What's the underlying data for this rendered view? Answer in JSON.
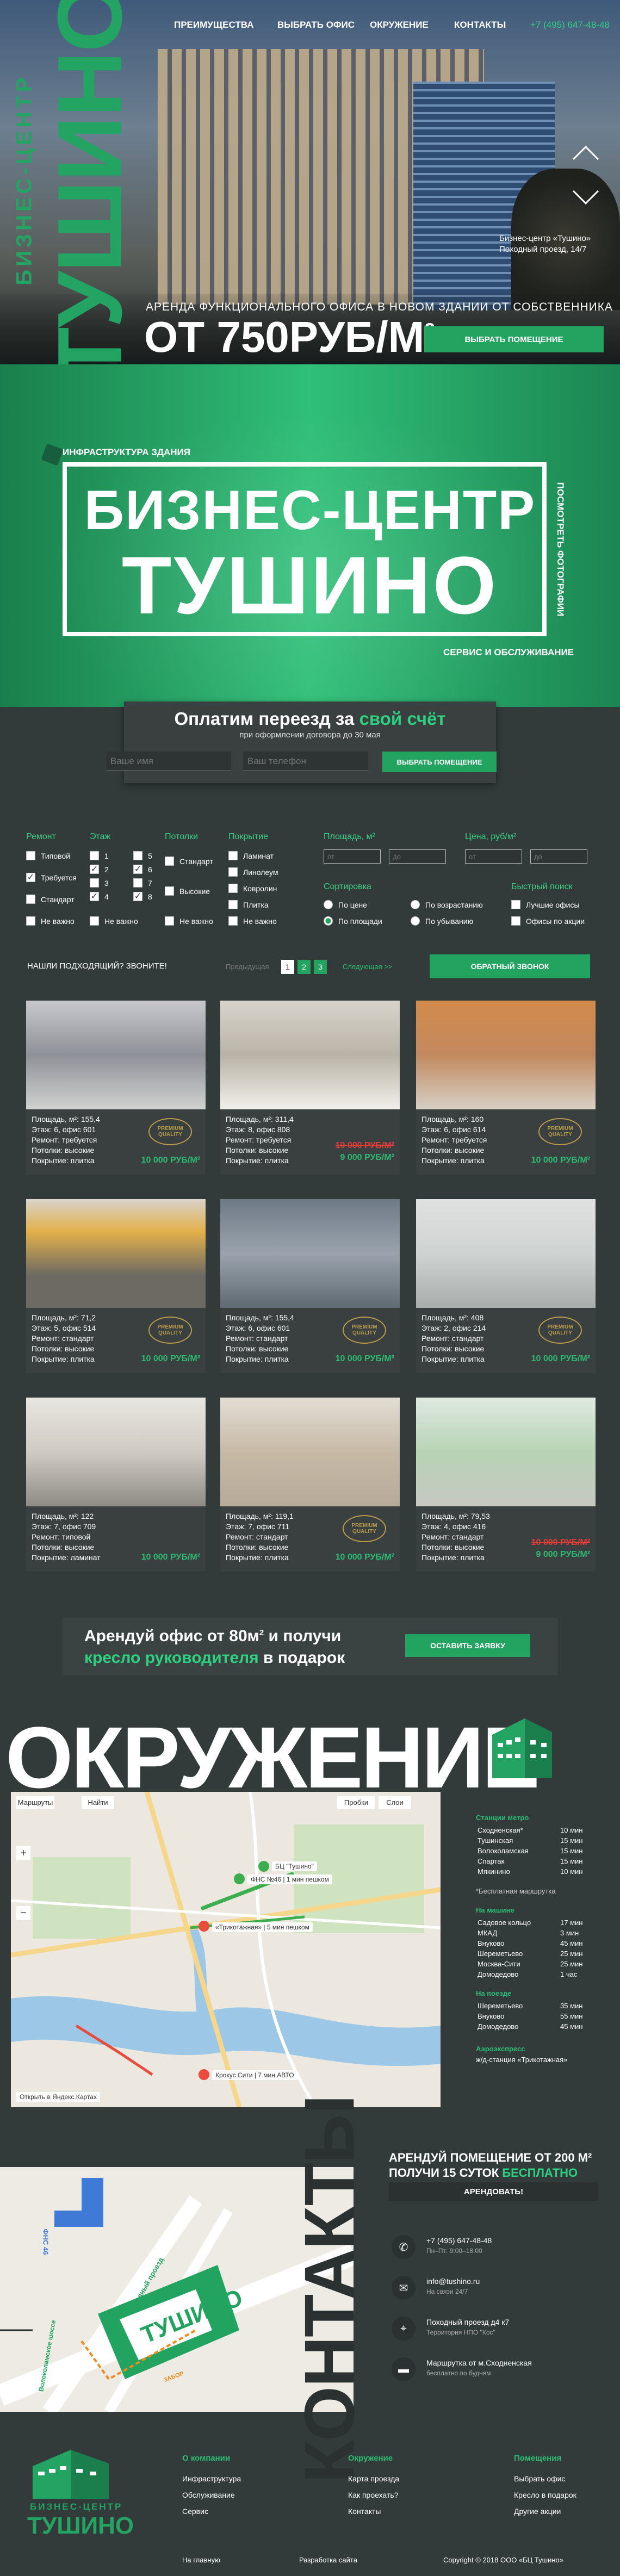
{
  "header": {
    "logo_vertical_top": "БИЗНЕС-ЦЕНТР",
    "logo_vertical_bottom": "ТУШИНО",
    "nav": [
      "ПРЕИМУЩЕСТВА",
      "ВЫБРАТЬ ОФИС",
      "ОКРУЖЕНИЕ",
      "КОНТАКТЫ"
    ],
    "phone": "+7 (495) 647-48-48",
    "photo_caption_1": "Бизнес-центр «Тушино»",
    "photo_caption_2": "Походный проезд, 14/7",
    "tagline": "АРЕНДА ФУНКЦИОНАЛЬНОГО ОФИСА В НОВОМ ЗДАНИИ ОТ СОБСТВЕННИКА",
    "price_prefix": "ОТ 750РУБ/М",
    "price_sup": "2",
    "cta": "ВЫБРАТЬ ПОМЕЩЕНИЕ"
  },
  "banner": {
    "side_top": "ИНФРАСТРУКТУРА ЗДАНИЯ",
    "side_right": "ПОСМОТРЕТЬ ФОТОГРАФИИ",
    "side_bottom": "СЕРВИС И ОБСЛУЖИВАНИЕ",
    "title_1": "БИЗНЕС-ЦЕНТР",
    "title_2": "ТУШИНО"
  },
  "move_form": {
    "title_prefix": "Оплатим переезд за ",
    "title_highlight": "свой счёт",
    "subtitle": "при оформлении договора до 30 мая",
    "name_placeholder": "Ваше имя",
    "phone_placeholder": "Ваш телефон",
    "submit": "ВЫБРАТЬ ПОМЕЩЕНИЕ"
  },
  "filters": {
    "repair": {
      "label": "Ремонт",
      "options": [
        "Типовой",
        "Требуется",
        "Стандарт",
        "Не важно"
      ]
    },
    "floor": {
      "label": "Этаж",
      "options": [
        "1",
        "2",
        "3",
        "4",
        "5",
        "6",
        "7",
        "8",
        "Не важно"
      ]
    },
    "ceiling": {
      "label": "Потолки",
      "options": [
        "Стандарт",
        "Высокие",
        "Не важно"
      ]
    },
    "cover": {
      "label": "Покрытие",
      "options": [
        "Ламинат",
        "Линолеум",
        "Ковролин",
        "Плитка",
        "Не важно"
      ]
    },
    "area": {
      "label": "Площадь, м²",
      "from": "от",
      "to": "до"
    },
    "price": {
      "label": "Цена, руб/м²",
      "from": "от",
      "to": "до"
    },
    "sort": {
      "label": "Сортировка",
      "options": [
        "По цене",
        "По возрастанию",
        "По площади",
        "По убыванию"
      ]
    },
    "quick": {
      "label": "Быстрый поиск",
      "options": [
        "Лучшие офисы",
        "Офисы по акции"
      ]
    }
  },
  "listing": {
    "hint": "НАШЛИ ПОДХОДЯЩИЙ? ЗВОНИТЕ!",
    "prev": "Предыдущая",
    "pages": [
      "1",
      "2",
      "3"
    ],
    "next": "Следующая >>",
    "callback": "ОБРАТНЫЙ ЗВОНОК"
  },
  "offices": [
    {
      "area": "Площадь, м²: 155,4",
      "floor": "Этаж: 6, офис 601",
      "repair": "Ремонт: требуется",
      "ceiling": "Потолки: высокие",
      "cover": "Покрытие: плитка",
      "old": "",
      "price": "10 000 РУБ/М²",
      "badge": true
    },
    {
      "area": "Площадь, м²: 311,4",
      "floor": "Этаж: 8, офис 808",
      "repair": "Ремонт: требуется",
      "ceiling": "Потолки: высокие",
      "cover": "Покрытие: плитка",
      "old": "10 000 РУБ/М²",
      "price": "9 000 РУБ/М²",
      "badge": false
    },
    {
      "area": "Площадь, м²: 160",
      "floor": "Этаж: 6, офис 614",
      "repair": "Ремонт: требуется",
      "ceiling": "Потолки: высокие",
      "cover": "Покрытие: плитка",
      "old": "",
      "price": "10 000 РУБ/М²",
      "badge": true
    },
    {
      "area": "Площадь, м²: 71,2",
      "floor": "Этаж: 5, офис 514",
      "repair": "Ремонт: стандарт",
      "ceiling": "Потолки: высокие",
      "cover": "Покрытие: плитка",
      "old": "",
      "price": "10 000 РУБ/М²",
      "badge": true
    },
    {
      "area": "Площадь, м²: 155,4",
      "floor": "Этаж: 6, офис 601",
      "repair": "Ремонт: стандарт",
      "ceiling": "Потолки: высокие",
      "cover": "Покрытие: плитка",
      "old": "",
      "price": "10 000 РУБ/М²",
      "badge": true
    },
    {
      "area": "Площадь, м²: 408",
      "floor": "Этаж: 2, офис 214",
      "repair": "Ремонт: стандарт",
      "ceiling": "Потолки: высокие",
      "cover": "Покрытие: плитка",
      "old": "",
      "price": "10 000 РУБ/М²",
      "badge": true
    },
    {
      "area": "Площадь, м²: 122",
      "floor": "Этаж: 7, офис 709",
      "repair": "Ремонт: типовой",
      "ceiling": "Потолки: высокие",
      "cover": "Покрытие: ламинат",
      "old": "",
      "price": "10 000 РУБ/М²",
      "badge": false
    },
    {
      "area": "Площадь, м²: 119,1",
      "floor": "Этаж: 7, офис 711",
      "repair": "Ремонт: стандарт",
      "ceiling": "Потолки: высокие",
      "cover": "Покрытие: плитка",
      "old": "",
      "price": "10 000 РУБ/М²",
      "badge": true
    },
    {
      "area": "Площадь, м²: 79,53",
      "floor": "Этаж: 4, офис 416",
      "repair": "Ремонт: стандарт",
      "ceiling": "Потолки: высокие",
      "cover": "Покрытие: плитка",
      "old": "10 000 РУБ/М²",
      "price": "9 000 РУБ/М²",
      "badge": false
    }
  ],
  "badge": {
    "top": "PREMIUM",
    "bottom": "QUALITY"
  },
  "promo": {
    "line1_prefix": "Арендуй офис от 80м",
    "line1_sup": "2",
    "line1_suffix": " и получи",
    "line2_highlight": "кресло руководителя",
    "line2_suffix": " в подарок",
    "button": "ОСТАВИТЬ ЗАЯВКУ"
  },
  "environment": {
    "title": "ОКРУЖЕНИЕ",
    "map_controls": {
      "routes": "Маршруты",
      "find": "Найти",
      "traffic": "Пробки",
      "layers": "Слои"
    },
    "map_labels": [
      "БЦ \"Тушино\"",
      "ФНС №46 | 1 мин пешком",
      "«Трикотажная» | 5 мин пешком",
      "Крокус Сити | 7 мин АВТО"
    ],
    "map_footer": "Открыть в Яндекс.Картах",
    "metro_head": "Станции метро",
    "metro": [
      [
        "Сходненская*",
        "10 мин"
      ],
      [
        "Тушинская",
        "15 мин"
      ],
      [
        "Волоколамская",
        "15 мин"
      ],
      [
        "Спартак",
        "15 мин"
      ],
      [
        "Мякинино",
        "10 мин"
      ]
    ],
    "metro_note": "*Бесплатная маршрутка",
    "car_head": "На машине",
    "car": [
      [
        "Садовое кольцо",
        "17 мин"
      ],
      [
        "МКАД",
        "3 мин"
      ],
      [
        "Внуково",
        "45 мин"
      ],
      [
        "Шереметьево",
        "25 мин"
      ],
      [
        "Москва-Сити",
        "25 мин"
      ],
      [
        "Домодедово",
        "1 час"
      ]
    ],
    "air_head": "На поезде",
    "air": [
      [
        "Шереметьево",
        "35 мин"
      ],
      [
        "Внуково",
        "55 мин"
      ],
      [
        "Домодедово",
        "45 мин"
      ]
    ],
    "rail_head": "Аэроэкспресс",
    "rail": "ж/д-станция «Трикотажная»"
  },
  "contacts": {
    "title": "КОНТАКТЫ",
    "promo_1": "АРЕНДУЙ ПОМЕЩЕНИЕ ОТ 200 М²",
    "promo_2_prefix": "ПОЛУЧИ 15 СУТОК ",
    "promo_2_highlight": "БЕСПЛАТНО",
    "promo_btn": "АРЕНДОВАТЬ!",
    "phone": "+7 (495) 647-48-48",
    "phone_sub": "Пн–Пт: 9:00–18:00",
    "email": "info@tushino.ru",
    "email_sub": "На связи 24/7",
    "address": "Походный проезд д4 к7",
    "address_sub": "Территория НПО \"Кос\"",
    "bus": "Маршрутка от м.Сходненская",
    "bus_sub": "бесплатно по будням",
    "map_labels": [
      "Походный проезд",
      "ТУШИНО",
      "Волоколамское шоссе",
      "ФНС 46",
      "ЗАБОР"
    ]
  },
  "footer": {
    "logo_1": "БИЗНЕС-ЦЕНТР",
    "logo_2": "ТУШИНО",
    "col1_head": "О компании",
    "col1": [
      "Инфраструктура",
      "Обслуживание",
      "Сервис"
    ],
    "col2_head": "Окружение",
    "col2": [
      "Карта проезда",
      "Как проехать?",
      "Контакты"
    ],
    "col3_head": "Помещения",
    "col3": [
      "Выбрать офис",
      "Кресло в подарок",
      "Другие акции"
    ],
    "home": "На главную",
    "dev": "Разработка сайта",
    "copyright": "Copyright © 2018 ООО «БЦ Тушино»"
  },
  "colors": {
    "accent": "#22a35f",
    "bg": "#323a3a",
    "card": "#39403f",
    "red": "#e63b3b",
    "gold": "#b99a4a"
  }
}
